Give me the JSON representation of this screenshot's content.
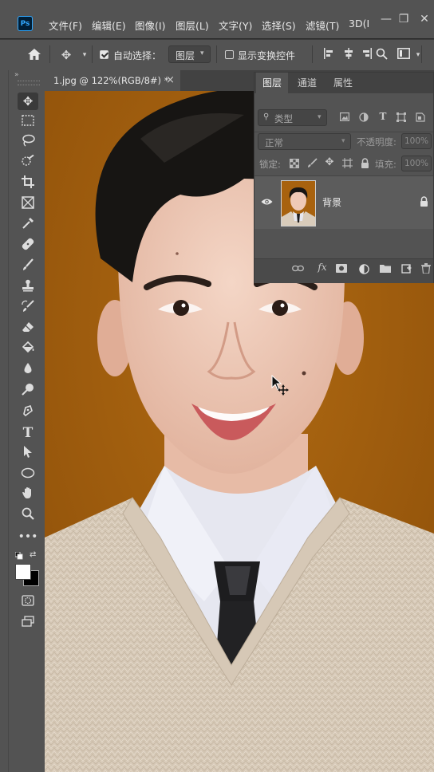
{
  "app": {
    "logo": "Ps"
  },
  "menu": [
    {
      "label": "文件(F)"
    },
    {
      "label": "编辑(E)"
    },
    {
      "label": "图像(I)"
    },
    {
      "label": "图层(L)"
    },
    {
      "label": "文字(Y)"
    },
    {
      "label": "选择(S)"
    },
    {
      "label": "滤镜(T)"
    },
    {
      "label": "3D(I"
    }
  ],
  "window_controls": {
    "minimize": "—",
    "restore": "❐",
    "close": "✕"
  },
  "options_bar": {
    "auto_select_label": "自动选择：",
    "auto_select_checked": true,
    "auto_select_target": "图层",
    "transform_controls_label": "显示变换控件",
    "transform_controls_checked": false
  },
  "document": {
    "tab_title": "1.jpg @ 122%(RGB/8#) *",
    "close": "×"
  },
  "layers_panel": {
    "tabs": [
      "图层",
      "通道",
      "属性"
    ],
    "active_tab": "图层",
    "filter_kind": "类型",
    "blend_mode": "正常",
    "opacity_label": "不透明度:",
    "opacity_value": "100%",
    "lock_label": "锁定:",
    "fill_label": "填充:",
    "fill_value": "100%",
    "layers": [
      {
        "name": "背景",
        "visible": true,
        "locked": true
      }
    ],
    "footer_fx": "fx"
  },
  "colors": {
    "canvas_background": "#a8620e",
    "ui_panel": "#535353",
    "ui_dark": "#282828",
    "accent": "#31a8ff"
  },
  "icons": {
    "toolbar": [
      "move-icon",
      "marquee-icon",
      "lasso-icon",
      "quick-select-icon",
      "crop-icon",
      "frame-icon",
      "eyedropper-icon",
      "healing-brush-icon",
      "brush-icon",
      "clone-stamp-icon",
      "history-brush-icon",
      "eraser-icon",
      "paint-bucket-icon",
      "blur-icon",
      "dodge-icon",
      "pen-icon",
      "type-icon",
      "path-select-icon",
      "ellipse-icon",
      "hand-icon",
      "zoom-icon",
      "more-tools-icon"
    ]
  }
}
